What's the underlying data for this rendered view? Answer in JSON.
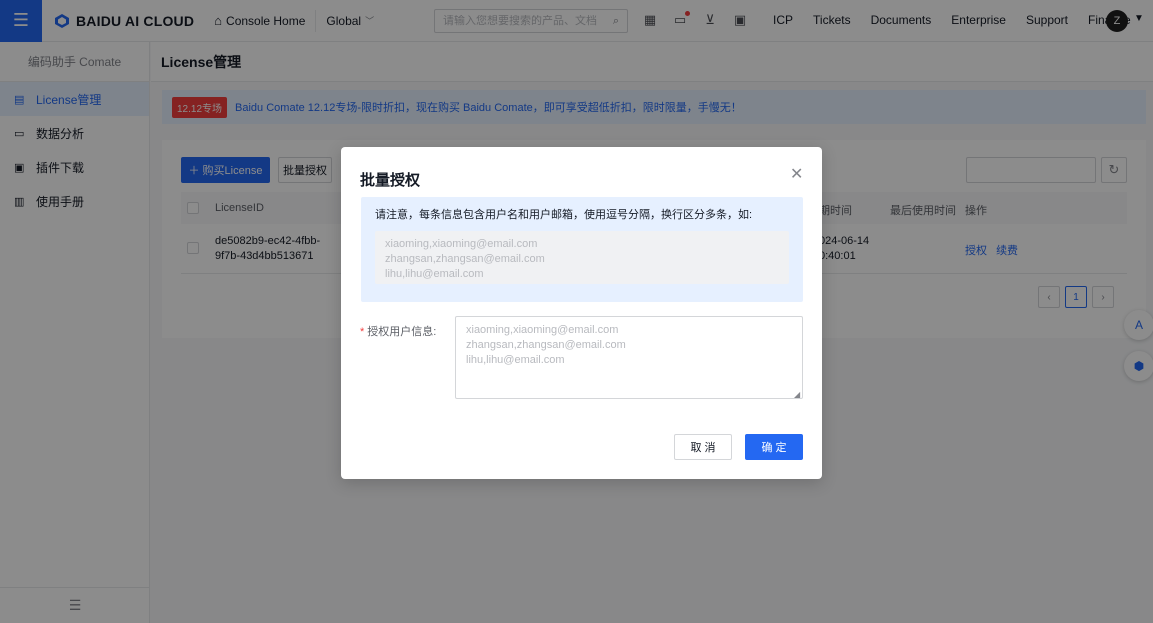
{
  "topbar": {
    "brand": "BAIDU AI CLOUD",
    "console_home": "Console Home",
    "region": "Global",
    "search_placeholder": "请输入您想要搜索的产品、文档",
    "links": [
      "ICP",
      "Tickets",
      "Documents",
      "Enterprise",
      "Support",
      "Finance"
    ],
    "avatar_letter": "Z"
  },
  "sidebar": {
    "title": "编码助手 Comate",
    "items": [
      {
        "label": "License管理",
        "icon": "license-icon",
        "active": true
      },
      {
        "label": "数据分析",
        "icon": "chart-icon",
        "active": false
      },
      {
        "label": "插件下载",
        "icon": "download-icon",
        "active": false
      },
      {
        "label": "使用手册",
        "icon": "manual-icon",
        "active": false
      }
    ]
  },
  "page": {
    "title": "License管理",
    "promo_tag": "12.12专场",
    "promo_text": "Baidu Comate 12.12专场-限时折扣，现在购买 Baidu Comate，即可享受超低折扣，限时限量，手慢无！",
    "buy_button": "＋ 购买License",
    "batch_button": "批量授权",
    "table": {
      "headers": {
        "id": "LicenseID",
        "expire": "期时间",
        "last_used": "最后使用时间",
        "ops": "操作"
      },
      "rows": [
        {
          "id_line1": "de5082b9-ec42-4fbb-",
          "id_line2": "9f7b-43d4bb513671",
          "expire_line1": "024-06-14",
          "expire_line2": "0:40:01",
          "op1": "授权",
          "op2": "续费"
        }
      ]
    },
    "pager": {
      "current": "1"
    }
  },
  "modal": {
    "title": "批量授权",
    "tip": "请注意，每条信息包含用户名和用户邮箱，使用逗号分隔，换行区分多条，如:",
    "example_lines": [
      "xiaoming,xiaoming@email.com",
      "zhangsan,zhangsan@email.com",
      "lihu,lihu@email.com"
    ],
    "field_label": "授权用户信息:",
    "field_placeholder": "xiaoming,xiaoming@email.com\nzhangsan,zhangsan@email.com\nlihu,lihu@email.com",
    "cancel": "取 消",
    "confirm": "确 定"
  }
}
